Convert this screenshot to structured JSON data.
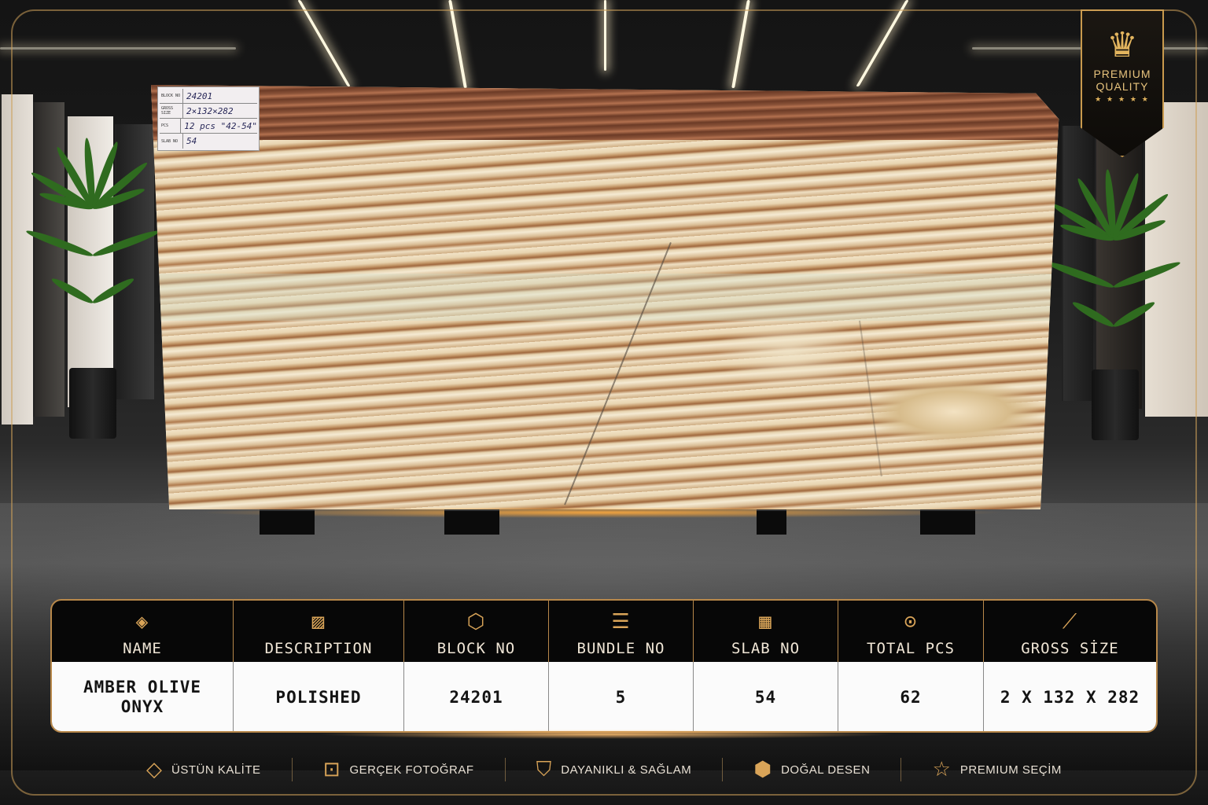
{
  "tag": {
    "rows": [
      {
        "key": "BLOCK NO",
        "value": "24201"
      },
      {
        "key": "GROSS SIZE",
        "value": "2×132×282"
      },
      {
        "key": "PCS",
        "value": "12 pcs   \"42-54\""
      },
      {
        "key": "SLAB NO",
        "value": "54"
      }
    ]
  },
  "badge": {
    "line1": "PREMIUM",
    "line2": "QUALITY",
    "stars": "★ ★ ★ ★ ★",
    "icon": "crown-icon"
  },
  "table": {
    "headers": [
      {
        "label": "NAME",
        "icon": "layers-icon"
      },
      {
        "label": "DESCRIPTION",
        "icon": "marble-pattern-icon"
      },
      {
        "label": "BLOCK NO",
        "icon": "cube-icon"
      },
      {
        "label": "BUNDLE NO",
        "icon": "stack-icon"
      },
      {
        "label": "SLAB NO",
        "icon": "grid-icon"
      },
      {
        "label": "TOTAL PCS",
        "icon": "measure-tape-icon"
      },
      {
        "label": "GROSS SİZE",
        "icon": "ruler-icon"
      }
    ],
    "values": [
      "AMBER OLIVE ONYX",
      "POLISHED",
      "24201",
      "5",
      "54",
      "62",
      "2 X 132 X 282"
    ]
  },
  "features": [
    {
      "label": "ÜSTÜN KALİTE",
      "icon": "diamond-icon"
    },
    {
      "label": "GERÇEK FOTOĞRAF",
      "icon": "camera-icon"
    },
    {
      "label": "DAYANIKLI & SAĞLAM",
      "icon": "shield-check-icon"
    },
    {
      "label": "DOĞAL DESEN",
      "icon": "cube-pattern-icon"
    },
    {
      "label": "PREMIUM SEÇİM",
      "icon": "star-icon"
    }
  ],
  "colors": {
    "gold": "#d9a458",
    "frame": "#b8884a",
    "panel": "#070707",
    "cell": "#fbfbfb"
  }
}
